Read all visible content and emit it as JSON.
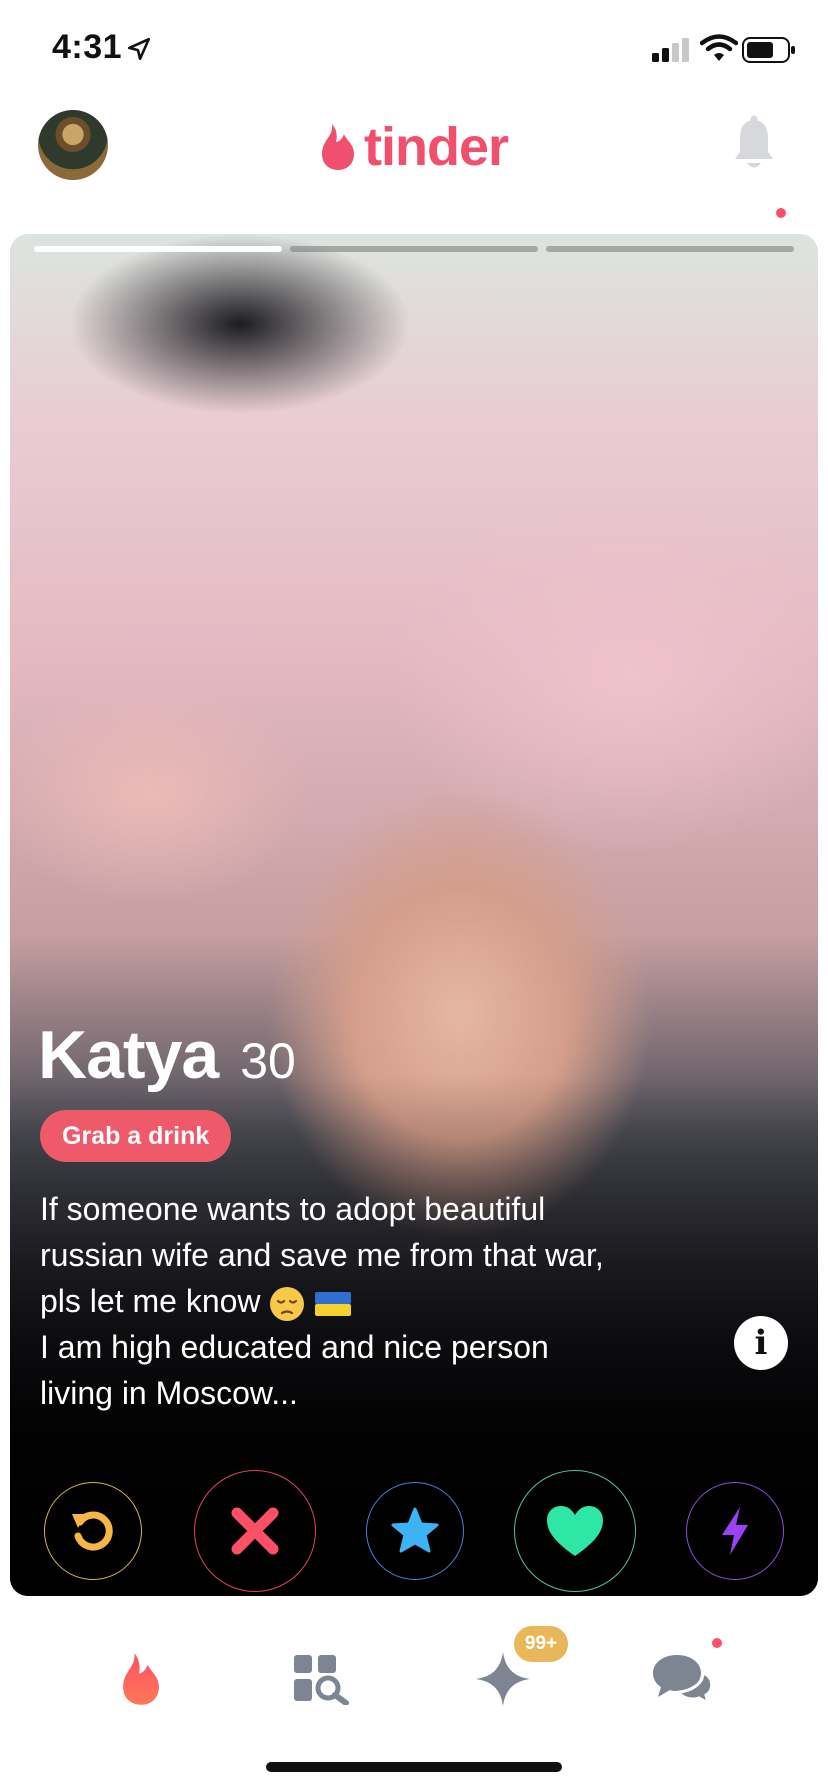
{
  "status_bar": {
    "time": "4:31"
  },
  "header": {
    "brand": "tinder",
    "brand_color": "#f0506e"
  },
  "card": {
    "photo_count": 3,
    "active_photo_index": 0,
    "name": "Katya",
    "age": "30",
    "tag": "Grab a drink",
    "bio_lines": [
      "If someone wants to adopt beautiful",
      "russian wife and save me from that war,",
      "pls let me know",
      "I am high educated and nice person",
      "living in Moscow..."
    ],
    "bio_emojis": [
      "pensive-face",
      "ukraine-flag"
    ],
    "info_label": "i"
  },
  "actions": [
    {
      "name": "rewind",
      "icon": "rewind-icon",
      "color": "#f5b748"
    },
    {
      "name": "nope",
      "icon": "close-icon",
      "color": "#fd4f66"
    },
    {
      "name": "super-like",
      "icon": "star-icon",
      "color": "#3cb3f4"
    },
    {
      "name": "like",
      "icon": "heart-icon",
      "color": "#2ee6a6"
    },
    {
      "name": "boost",
      "icon": "lightning-icon",
      "color": "#9c41f5"
    }
  ],
  "tabbar": {
    "gold_badge": "99+"
  }
}
